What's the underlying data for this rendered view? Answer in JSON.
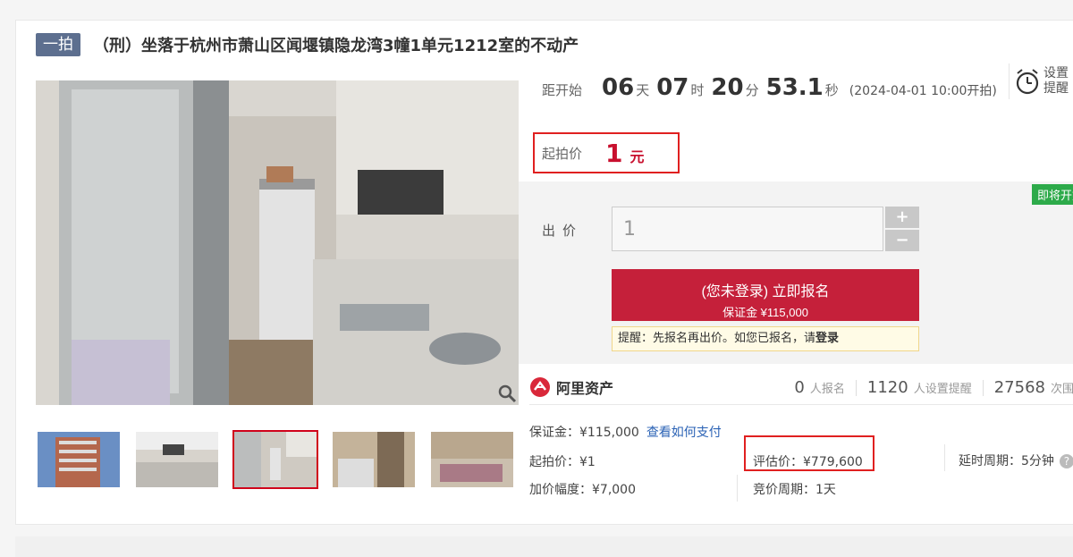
{
  "header": {
    "badge": "一拍",
    "title": "（刑）坐落于杭州市萧山区闻堰镇隐龙湾3幢1单元1212室的不动产"
  },
  "countdown": {
    "label": "距开始",
    "days": "06",
    "days_unit": "天",
    "hours": "07",
    "hours_unit": "时",
    "minutes": "20",
    "minutes_unit": "分",
    "seconds": "53.1",
    "seconds_unit": "秒",
    "start_time": "(2024-04-01 10:00开拍)"
  },
  "remind": {
    "line1": "设置",
    "line2": "提醒"
  },
  "start_price": {
    "label": "起拍价",
    "value": "1",
    "unit": "元"
  },
  "bid": {
    "soon_tag": "即将开始",
    "label": "出价",
    "input_value": "1",
    "plus": "+",
    "minus": "−",
    "signup_main": "(您未登录) 立即报名",
    "signup_sub": "保证金 ¥115,000",
    "hint_prefix": "提醒：先报名再出价。如您已报名，请",
    "hint_link": "登录"
  },
  "stats": {
    "logo_text": "阿里资产",
    "signups": "0",
    "signups_label": "人报名",
    "reminders": "1120",
    "reminders_label": "人设置提醒",
    "views": "27568",
    "views_label": "次围观"
  },
  "info": {
    "deposit": "保证金：¥115,000",
    "pay_link": "查看如何支付",
    "start_price": "起拍价：¥1",
    "eval_price": "评估价：¥779,600",
    "delay": "延时周期：5分钟",
    "increment": "加价幅度：¥7,000",
    "bid_cycle": "竞价周期：1天"
  },
  "colors": {
    "accent": "#c5203a",
    "badge": "#5d6f8f",
    "soon": "#2daa4a",
    "highlight_border": "#e02020"
  },
  "icons": [
    "alarm-clock-icon",
    "zoom-icon",
    "alibaba-asset-logo-icon",
    "question-icon"
  ]
}
